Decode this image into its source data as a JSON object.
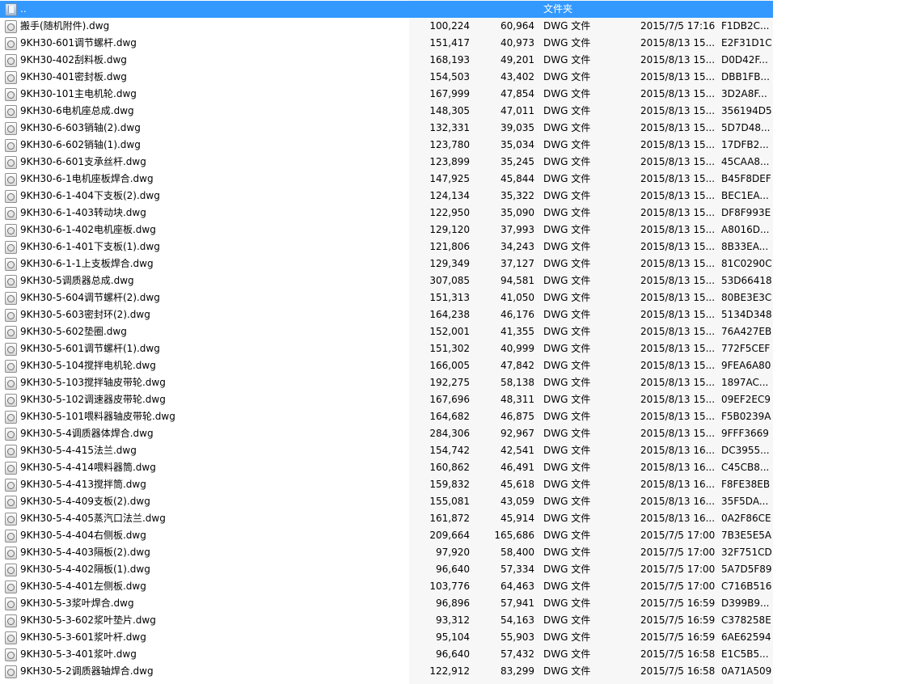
{
  "parent_row": {
    "name": "..",
    "type": "文件夹"
  },
  "files": [
    {
      "name": "搬手(随机附件).dwg",
      "size": "100,224",
      "packed": "60,964",
      "type": "DWG 文件",
      "modified": "2015/7/5 17:16",
      "crc": "F1DB2C..."
    },
    {
      "name": "9KH30-601调节螺杆.dwg",
      "size": "151,417",
      "packed": "40,973",
      "type": "DWG 文件",
      "modified": "2015/8/13 15...",
      "crc": "E2F31D1C"
    },
    {
      "name": "9KH30-402刮料板.dwg",
      "size": "168,193",
      "packed": "49,201",
      "type": "DWG 文件",
      "modified": "2015/8/13 15...",
      "crc": "D0D42F..."
    },
    {
      "name": "9KH30-401密封板.dwg",
      "size": "154,503",
      "packed": "43,402",
      "type": "DWG 文件",
      "modified": "2015/8/13 15...",
      "crc": "DBB1FB..."
    },
    {
      "name": "9KH30-101主电机轮.dwg",
      "size": "167,999",
      "packed": "47,854",
      "type": "DWG 文件",
      "modified": "2015/8/13 15...",
      "crc": "3D2A8F..."
    },
    {
      "name": "9KH30-6电机座总成.dwg",
      "size": "148,305",
      "packed": "47,011",
      "type": "DWG 文件",
      "modified": "2015/8/13 15...",
      "crc": "356194D5"
    },
    {
      "name": "9KH30-6-603销轴(2).dwg",
      "size": "132,331",
      "packed": "39,035",
      "type": "DWG 文件",
      "modified": "2015/8/13 15...",
      "crc": "5D7D48..."
    },
    {
      "name": "9KH30-6-602销轴(1).dwg",
      "size": "123,780",
      "packed": "35,034",
      "type": "DWG 文件",
      "modified": "2015/8/13 15...",
      "crc": "17DFB2..."
    },
    {
      "name": "9KH30-6-601支承丝杆.dwg",
      "size": "123,899",
      "packed": "35,245",
      "type": "DWG 文件",
      "modified": "2015/8/13 15...",
      "crc": "45CAA8..."
    },
    {
      "name": "9KH30-6-1电机座板焊合.dwg",
      "size": "147,925",
      "packed": "45,844",
      "type": "DWG 文件",
      "modified": "2015/8/13 15...",
      "crc": "B45F8DEF"
    },
    {
      "name": "9KH30-6-1-404下支板(2).dwg",
      "size": "124,134",
      "packed": "35,322",
      "type": "DWG 文件",
      "modified": "2015/8/13 15...",
      "crc": "BEC1EA..."
    },
    {
      "name": "9KH30-6-1-403转动块.dwg",
      "size": "122,950",
      "packed": "35,090",
      "type": "DWG 文件",
      "modified": "2015/8/13 15...",
      "crc": "DF8F993E"
    },
    {
      "name": "9KH30-6-1-402电机座板.dwg",
      "size": "129,120",
      "packed": "37,993",
      "type": "DWG 文件",
      "modified": "2015/8/13 15...",
      "crc": "A8016D..."
    },
    {
      "name": "9KH30-6-1-401下支板(1).dwg",
      "size": "121,806",
      "packed": "34,243",
      "type": "DWG 文件",
      "modified": "2015/8/13 15...",
      "crc": "8B33EA..."
    },
    {
      "name": "9KH30-6-1-1上支板焊合.dwg",
      "size": "129,349",
      "packed": "37,127",
      "type": "DWG 文件",
      "modified": "2015/8/13 15...",
      "crc": "81C0290C"
    },
    {
      "name": "9KH30-5调质器总成.dwg",
      "size": "307,085",
      "packed": "94,581",
      "type": "DWG 文件",
      "modified": "2015/8/13 15...",
      "crc": "53D66418"
    },
    {
      "name": "9KH30-5-604调节螺杆(2).dwg",
      "size": "151,313",
      "packed": "41,050",
      "type": "DWG 文件",
      "modified": "2015/8/13 15...",
      "crc": "80BE3E3C"
    },
    {
      "name": "9KH30-5-603密封环(2).dwg",
      "size": "164,238",
      "packed": "46,176",
      "type": "DWG 文件",
      "modified": "2015/8/13 15...",
      "crc": "5134D348"
    },
    {
      "name": "9KH30-5-602垫圈.dwg",
      "size": "152,001",
      "packed": "41,355",
      "type": "DWG 文件",
      "modified": "2015/8/13 15...",
      "crc": "76A427EB"
    },
    {
      "name": "9KH30-5-601调节螺杆(1).dwg",
      "size": "151,302",
      "packed": "40,999",
      "type": "DWG 文件",
      "modified": "2015/8/13 15...",
      "crc": "772F5CEF"
    },
    {
      "name": "9KH30-5-104搅拌电机轮.dwg",
      "size": "166,005",
      "packed": "47,842",
      "type": "DWG 文件",
      "modified": "2015/8/13 15...",
      "crc": "9FEA6A80"
    },
    {
      "name": "9KH30-5-103搅拌轴皮带轮.dwg",
      "size": "192,275",
      "packed": "58,138",
      "type": "DWG 文件",
      "modified": "2015/8/13 15...",
      "crc": "1897AC..."
    },
    {
      "name": "9KH30-5-102调速器皮带轮.dwg",
      "size": "167,696",
      "packed": "48,311",
      "type": "DWG 文件",
      "modified": "2015/8/13 15...",
      "crc": "09EF2EC9"
    },
    {
      "name": "9KH30-5-101喂料器轴皮带轮.dwg",
      "size": "164,682",
      "packed": "46,875",
      "type": "DWG 文件",
      "modified": "2015/8/13 15...",
      "crc": "F5B0239A"
    },
    {
      "name": "9KH30-5-4调质器体焊合.dwg",
      "size": "284,306",
      "packed": "92,967",
      "type": "DWG 文件",
      "modified": "2015/8/13 15...",
      "crc": "9FFF3669"
    },
    {
      "name": "9KH30-5-4-415法兰.dwg",
      "size": "154,742",
      "packed": "42,541",
      "type": "DWG 文件",
      "modified": "2015/8/13 16...",
      "crc": "DC3955..."
    },
    {
      "name": "9KH30-5-4-414喂料器筒.dwg",
      "size": "160,862",
      "packed": "46,491",
      "type": "DWG 文件",
      "modified": "2015/8/13 16...",
      "crc": "C45CB8..."
    },
    {
      "name": "9KH30-5-4-413搅拌筒.dwg",
      "size": "159,832",
      "packed": "45,618",
      "type": "DWG 文件",
      "modified": "2015/8/13 16...",
      "crc": "F8FE38EB"
    },
    {
      "name": "9KH30-5-4-409支板(2).dwg",
      "size": "155,081",
      "packed": "43,059",
      "type": "DWG 文件",
      "modified": "2015/8/13 16...",
      "crc": "35F5DA..."
    },
    {
      "name": "9KH30-5-4-405蒸汽口法兰.dwg",
      "size": "161,872",
      "packed": "45,914",
      "type": "DWG 文件",
      "modified": "2015/8/13 16...",
      "crc": "0A2F86CE"
    },
    {
      "name": "9KH30-5-4-404右侧板.dwg",
      "size": "209,664",
      "packed": "165,686",
      "type": "DWG 文件",
      "modified": "2015/7/5 17:00",
      "crc": "7B3E5E5A"
    },
    {
      "name": "9KH30-5-4-403隔板(2).dwg",
      "size": "97,920",
      "packed": "58,400",
      "type": "DWG 文件",
      "modified": "2015/7/5 17:00",
      "crc": "32F751CD"
    },
    {
      "name": "9KH30-5-4-402隔板(1).dwg",
      "size": "96,640",
      "packed": "57,334",
      "type": "DWG 文件",
      "modified": "2015/7/5 17:00",
      "crc": "5A7D5F89"
    },
    {
      "name": "9KH30-5-4-401左侧板.dwg",
      "size": "103,776",
      "packed": "64,463",
      "type": "DWG 文件",
      "modified": "2015/7/5 17:00",
      "crc": "C716B516"
    },
    {
      "name": "9KH30-5-3浆叶焊合.dwg",
      "size": "96,896",
      "packed": "57,941",
      "type": "DWG 文件",
      "modified": "2015/7/5 16:59",
      "crc": "D399B9..."
    },
    {
      "name": "9KH30-5-3-602浆叶垫片.dwg",
      "size": "93,312",
      "packed": "54,163",
      "type": "DWG 文件",
      "modified": "2015/7/5 16:59",
      "crc": "C378258E"
    },
    {
      "name": "9KH30-5-3-601浆叶杆.dwg",
      "size": "95,104",
      "packed": "55,903",
      "type": "DWG 文件",
      "modified": "2015/7/5 16:59",
      "crc": "6AE62594"
    },
    {
      "name": "9KH30-5-3-401浆叶.dwg",
      "size": "96,640",
      "packed": "57,432",
      "type": "DWG 文件",
      "modified": "2015/7/5 16:58",
      "crc": "E1C5B5..."
    },
    {
      "name": "9KH30-5-2调质器轴焊合.dwg",
      "size": "122,912",
      "packed": "83,299",
      "type": "DWG 文件",
      "modified": "2015/7/5 16:58",
      "crc": "0A71A509"
    }
  ],
  "colors": {
    "selection": "#3399ff",
    "row_text": "#000000",
    "right_pane": "#f7f7f7"
  }
}
